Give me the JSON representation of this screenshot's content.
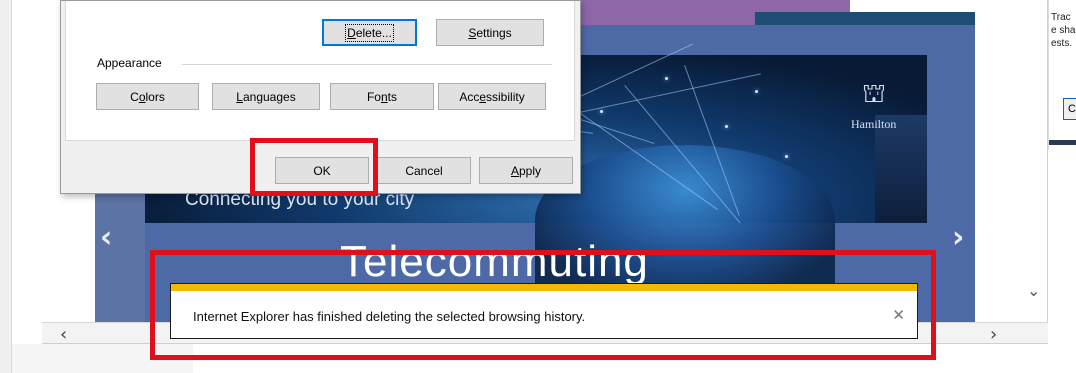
{
  "dialog": {
    "buttons_top": [
      {
        "label": "Delete...",
        "mnemonic": "D",
        "focused": true
      },
      {
        "label": "Settings",
        "mnemonic": "S"
      }
    ],
    "appearance_label": "Appearance",
    "appearance_buttons": [
      "Colors",
      "Languages",
      "Fonts",
      "Accessibility"
    ],
    "footer_buttons": {
      "ok": "OK",
      "cancel": "Cancel",
      "apply": "Apply"
    }
  },
  "banner": {
    "tagline": "Connecting you to your city",
    "logo_text": "Hamilton"
  },
  "slide": {
    "title": "Telecommuting"
  },
  "notification": {
    "message": "Internet Explorer has finished deleting the selected browsing history.",
    "close_icon": "close-icon",
    "accent_color": "#f5b800"
  },
  "side_panel": {
    "lines": [
      "Trac",
      "e shar",
      "ests."
    ],
    "button_label": "Ca"
  },
  "highlight_color": "#e0101a"
}
